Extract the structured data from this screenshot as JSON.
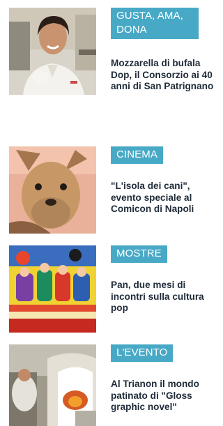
{
  "colors": {
    "category_bg": "#48a9c6",
    "category_text": "#ffffff",
    "title_text": "#1f2b38"
  },
  "articles": [
    {
      "category": "GUSTA, AMA, DONA",
      "title": "Mozzarella di bufala Dop, il Consorzio ai 40 anni di San Patrignano",
      "image": "chef-portrait"
    },
    {
      "category": "CINEMA",
      "title": "\"L'isola dei cani\", evento speciale al Comicon di Napoli",
      "image": "dog-still"
    },
    {
      "category": "MOSTRE",
      "title": "Pan, due mesi di incontri sulla cultura pop",
      "image": "yellow-submarine-art"
    },
    {
      "category": "L'EVENTO",
      "title": "Al Trianon il mondo patinato di \"Gloss graphic novel\"",
      "image": "theatre-interior"
    }
  ]
}
